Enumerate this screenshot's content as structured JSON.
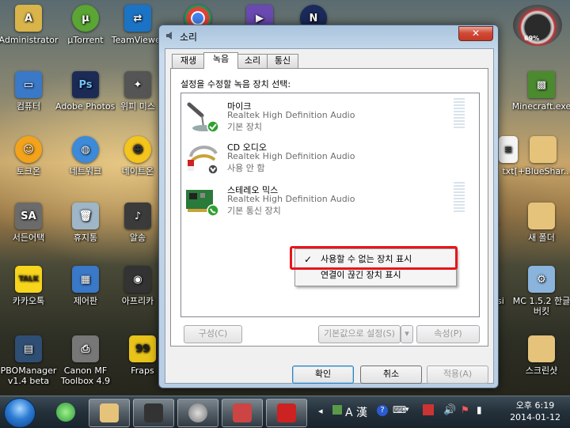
{
  "desktop": {
    "icons": [
      {
        "label": "Administrator",
        "color": "#d9b44a"
      },
      {
        "label": "µTorrent",
        "color": "#5aa533"
      },
      {
        "label": "TeamViewer",
        "color": "#1b73c6"
      },
      {
        "label": "컴퓨터",
        "color": "#3a78c8"
      },
      {
        "label": "Adobe Photosho...",
        "color": "#1c2b56"
      },
      {
        "label": "위피 미스",
        "color": "#555555"
      },
      {
        "label": "토크온",
        "color": "#f3a31b"
      },
      {
        "label": "네트워크",
        "color": "#3c8ad8"
      },
      {
        "label": "네이트온",
        "color": "#f4c51c"
      },
      {
        "label": "서든어택",
        "color": "#6b6b6b"
      },
      {
        "label": "휴지통",
        "color": "#9fb6c8"
      },
      {
        "label": "알송",
        "color": "#3b3b3b"
      },
      {
        "label": "카카오톡",
        "color": "#f7d51d"
      },
      {
        "label": "제어판",
        "color": "#3a78c8"
      },
      {
        "label": "아프리카",
        "color": "#333333"
      },
      {
        "label": "PBOManager v1.4 beta",
        "color": "#2f4e74"
      },
      {
        "label": "Canon MF Toolbox 4.9",
        "color": "#777777"
      },
      {
        "label": "Fraps",
        "color": "#e8c31a"
      },
      {
        "label": "Minecraft.exe",
        "color": "#4b8a2f"
      },
      {
        "label": "txt",
        "color": "#ffffff"
      },
      {
        "label": "[+BlueShar...",
        "color": "#e6c37a"
      },
      {
        "label": "새 폴더",
        "color": "#e6c37a"
      },
      {
        "label": "드",
        "color": "#e6c37a"
      },
      {
        "label": "nsi",
        "color": "#aaaaaa"
      },
      {
        "label": "MC 1.5.2 한글버킷",
        "color": "#8ab4dc"
      },
      {
        "label": "스크린샷",
        "color": "#e6c37a"
      }
    ],
    "gauge_value": "69%"
  },
  "dialog": {
    "title": "소리",
    "close_glyph": "✕",
    "tabs": [
      "재생",
      "녹음",
      "소리",
      "통신"
    ],
    "active_tab": 1,
    "prompt": "설정을 수정할 녹음 장치 선택:",
    "devices": [
      {
        "name": "마이크",
        "driver": "Realtek High Definition Audio",
        "status": "기본 장치",
        "badge": "check",
        "badge_color": "#2fa12f"
      },
      {
        "name": "CD 오디오",
        "driver": "Realtek High Definition Audio",
        "status": "사용 안 함",
        "badge": "down",
        "badge_color": "#4a4a4a"
      },
      {
        "name": "스테레오 믹스",
        "driver": "Realtek High Definition Audio",
        "status": "기본 통신 장치",
        "badge": "phone",
        "badge_color": "#2fa12f"
      }
    ],
    "buttons": {
      "configure": "구성(C)",
      "set_default": "기본값으로 설정(S)",
      "properties": "속성(P)",
      "ok": "확인",
      "cancel": "취소",
      "apply": "적용(A)"
    },
    "context_menu": {
      "items": [
        {
          "label": "사용할 수 없는 장치 표시",
          "checked": true
        },
        {
          "label": "연결이 끊긴 장치 표시",
          "checked": false
        }
      ],
      "check_glyph": "✓"
    }
  },
  "taskbar": {
    "tray_text": "A 漢",
    "time": "오후 6:19",
    "date": "2014-01-12"
  },
  "colors": {
    "highlight_red": "#e8151b",
    "taskbar_bg": "#23303a"
  }
}
